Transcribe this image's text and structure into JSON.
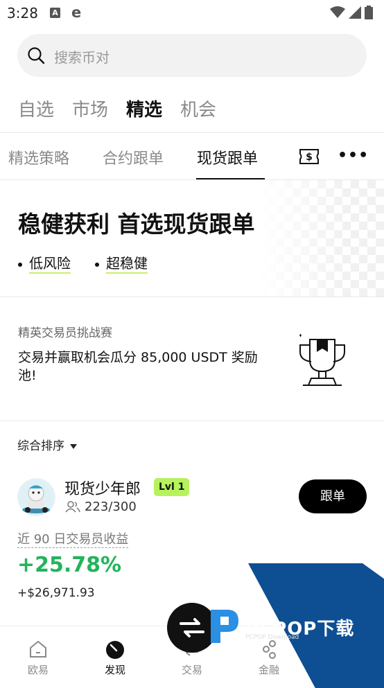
{
  "status_bar": {
    "time": "3:28",
    "a_icon_letter": "A",
    "e_icon_letter": "e"
  },
  "search": {
    "placeholder": "搜索币对"
  },
  "top_tabs": [
    {
      "label": "自选",
      "active": false
    },
    {
      "label": "市场",
      "active": false
    },
    {
      "label": "精选",
      "active": true
    },
    {
      "label": "机会",
      "active": false
    }
  ],
  "sub_tabs": [
    {
      "label": "精选策略",
      "active": false
    },
    {
      "label": "合约跟单",
      "active": false
    },
    {
      "label": "现货跟单",
      "active": true
    }
  ],
  "banner": {
    "title": "稳健获利 首选现货跟单",
    "bullets": [
      "低风险",
      "超稳健"
    ]
  },
  "challenge": {
    "label": "精英交易员挑战赛",
    "text": "交易并赢取机会瓜分 85,000 USDT 奖励池!"
  },
  "sort": {
    "label": "综合排序"
  },
  "trader": {
    "name": "现货少年郎",
    "level": "Lvl 1",
    "followers": "223/300",
    "follow_label": "跟单",
    "pnl_label": "近 90 日交易员收益",
    "pnl_percent": "+25.78%",
    "pnl_amount": "+$26,971.93"
  },
  "watermark": {
    "brand": "PCPOP下载",
    "sub": "PCPOP Download"
  },
  "bottom_nav": [
    {
      "label": "欧易",
      "icon": "home-icon",
      "active": false
    },
    {
      "label": "发现",
      "icon": "discover-icon",
      "active": true
    },
    {
      "label": "交易",
      "icon": "trade-icon",
      "active": false
    },
    {
      "label": "金融",
      "icon": "finance-icon",
      "active": false
    }
  ],
  "colors": {
    "profit_green": "#23b35c",
    "accent_lime": "#b6f25c",
    "watermark_blue": "#0e4e93"
  }
}
